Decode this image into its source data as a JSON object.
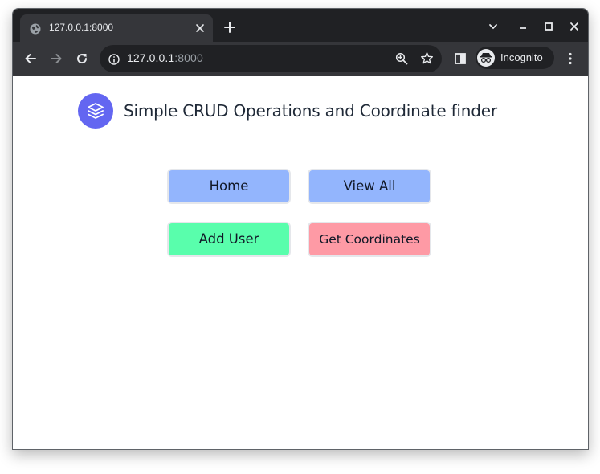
{
  "browser": {
    "tab": {
      "title": "127.0.0.1:8000"
    },
    "address": {
      "host": "127.0.0.1",
      "port": ":8000"
    },
    "profile_label": "Incognito"
  },
  "page": {
    "title": "Simple CRUD Operations and Coordinate finder",
    "buttons": {
      "home": "Home",
      "view_all": "View All",
      "add_user": "Add User",
      "get_coordinates": "Get Coordinates"
    }
  },
  "colors": {
    "brand": "#6366f1",
    "home_bg": "#93b5fd",
    "view_all_bg": "#93b5fd",
    "add_user_bg": "#59feac",
    "get_coordinates_bg": "#fe9aa5"
  }
}
